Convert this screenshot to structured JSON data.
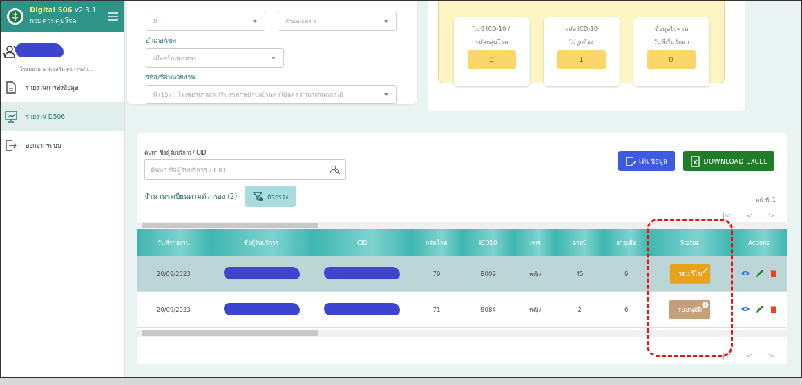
{
  "app": {
    "name": "Digital 506",
    "version": "v2.3.1",
    "org": "กรมควบคุมโรค"
  },
  "user": {
    "unit": "โรงพยาบาลส่งเสริมสุขภาพตำ..."
  },
  "sidebar": {
    "items": [
      {
        "label": "รายงานการส่งข้อมูล",
        "kind": "document",
        "selected": false
      },
      {
        "label": "รายงาน D506",
        "kind": "monitor",
        "selected": true
      },
      {
        "label": "ออกจากระบบ",
        "kind": "logout",
        "selected": false
      }
    ]
  },
  "filters": [
    {
      "value": "03"
    },
    {
      "value": "กำแพงเพชร"
    },
    {
      "label": "อำเภอ/เขต",
      "value": "เมืองกำแพงเพชร"
    },
    {
      "label": "รหัส/ชื่อหน่วยงาน",
      "value": "07157 : โรงพยาบาลส่งเสริมสุขภาพตำบลบ้านท่าไม้แดง ตำบลลานดอกไม้"
    }
  ],
  "summary": [
    {
      "line1": "ไม่มี ICD-10 /",
      "line2": "รหัสกลุ่มโรค",
      "count": "0"
    },
    {
      "line1": "รหัส ICD-10",
      "line2": "ไม่ถูกต้อง",
      "count": "1"
    },
    {
      "line1": "ข้อมูลไม่ครบ",
      "line2": "วันที่เริ่มรักษา",
      "count": "0"
    }
  ],
  "search": {
    "label": "ค้นหา ชื่อผู้รับบริการ / CID",
    "placeholder": "ค้นหา ชื่อผู้รับบริการ / CID"
  },
  "record_count": "จำนวนระเบียนตามตัวกรอง (2)",
  "filter_button": "ตัวกรอง",
  "buttons": [
    {
      "label": "เพิ่มข้อมูล",
      "kind": "add"
    },
    {
      "label": "DOWNLOAD EXCEL",
      "kind": "excel"
    }
  ],
  "page_label": "หน้าที่: 1",
  "pager": [
    "|<",
    "<",
    ">"
  ],
  "table": {
    "columns": [
      {
        "label": "วันที่รายงาน",
        "circled": false
      },
      {
        "label": "ชื่อผู้รับบริการ",
        "circled": false
      },
      {
        "label": "CID",
        "circled": false
      },
      {
        "label": "กลุ่มโรค",
        "circled": false
      },
      {
        "label": "ICD10",
        "circled": false
      },
      {
        "label": "เพศ",
        "circled": false
      },
      {
        "label": "อายุปี",
        "circled": false
      },
      {
        "label": "อายุเดือ",
        "circled": false
      },
      {
        "label": "Status",
        "circled": true
      },
      {
        "label": "Actions",
        "circled": false
      }
    ],
    "rows": [
      {
        "selected": true,
        "cells": [
          {
            "kind": "text",
            "text": "20/09/2023"
          },
          {
            "kind": "redacted"
          },
          {
            "kind": "redacted"
          },
          {
            "kind": "text",
            "text": "79"
          },
          {
            "kind": "text",
            "text": "B009"
          },
          {
            "kind": "text",
            "text": "หญิง"
          },
          {
            "kind": "text",
            "text": "45"
          },
          {
            "kind": "text",
            "text": "9"
          }
        ],
        "status": {
          "label": "รอแก้ไข",
          "kind": "edit",
          "color": "#e9a319"
        }
      },
      {
        "selected": false,
        "cells": [
          {
            "kind": "text",
            "text": "20/09/2023"
          },
          {
            "kind": "redacted"
          },
          {
            "kind": "redacted"
          },
          {
            "kind": "text",
            "text": "71"
          },
          {
            "kind": "text",
            "text": "B084"
          },
          {
            "kind": "text",
            "text": "หญิง"
          },
          {
            "kind": "text",
            "text": "2"
          },
          {
            "kind": "text",
            "text": "6"
          }
        ],
        "status": {
          "label": "รออนุมัติ",
          "kind": "info",
          "color": "#c4a07a"
        }
      }
    ]
  },
  "bottom_pager": [
    "|<",
    "<",
    ">"
  ]
}
